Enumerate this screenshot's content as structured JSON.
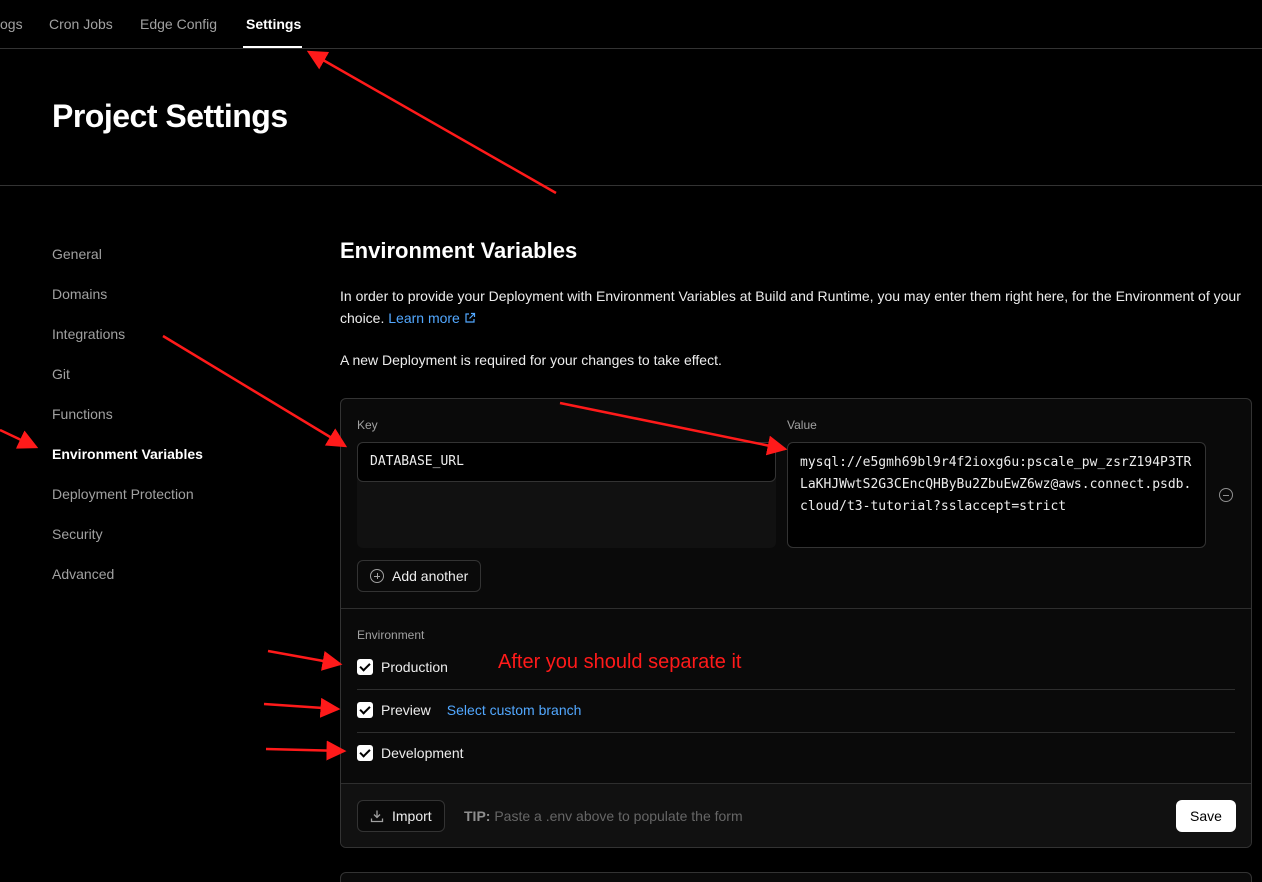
{
  "topnav": {
    "tabs": [
      {
        "label": "ogs"
      },
      {
        "label": "Cron Jobs"
      },
      {
        "label": "Edge Config"
      },
      {
        "label": "Settings"
      }
    ]
  },
  "page": {
    "title": "Project Settings"
  },
  "sidebar": {
    "items": [
      {
        "label": "General"
      },
      {
        "label": "Domains"
      },
      {
        "label": "Integrations"
      },
      {
        "label": "Git"
      },
      {
        "label": "Functions"
      },
      {
        "label": "Environment Variables"
      },
      {
        "label": "Deployment Protection"
      },
      {
        "label": "Security"
      },
      {
        "label": "Advanced"
      }
    ]
  },
  "env": {
    "title": "Environment Variables",
    "description": "In order to provide your Deployment with Environment Variables at Build and Runtime, you may enter them right here, for the Environment of your choice.",
    "learn_more": "Learn more",
    "notice": "A new Deployment is required for your changes to take effect.",
    "key_label": "Key",
    "value_label": "Value",
    "key_value": "DATABASE_URL",
    "value_value": "mysql://e5gmh69bl9r4f2ioxg6u:pscale_pw_zsrZ194P3TRLaKHJWwtS2G3CEncQHByBu2ZbuEwZ6wz@aws.connect.psdb.cloud/t3-tutorial?sslaccept=strict",
    "add_another": "Add another",
    "environment_label": "Environment",
    "environments": [
      {
        "label": "Production",
        "checked": true
      },
      {
        "label": "Preview",
        "checked": true,
        "link": "Select custom branch"
      },
      {
        "label": "Development",
        "checked": true
      }
    ],
    "import_label": "Import",
    "tip_label": "TIP:",
    "tip_text": "Paste a .env above to populate the form",
    "save_label": "Save"
  },
  "annotation": {
    "text": "After you should separate it",
    "color": "#ff1a1a"
  },
  "colors": {
    "link": "#52a8ff",
    "background": "#000000",
    "annotation": "#ff1a1a"
  }
}
